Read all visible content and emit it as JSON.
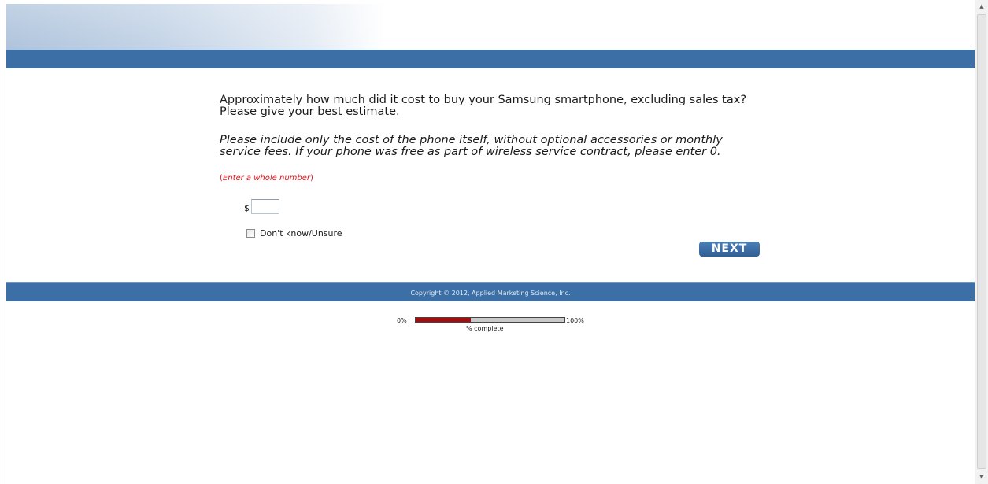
{
  "question": {
    "text": "Approximately how much did it cost to buy your Samsung smartphone, excluding sales tax? Please give your best estimate.",
    "instructions": "Please include only the cost of the phone itself, without optional accessories or monthly service fees. If your phone was free as part of wireless service contract, please enter 0.",
    "hint_open": "(",
    "hint": "Enter a whole number",
    "hint_close": ")"
  },
  "answer": {
    "currency_symbol": "$",
    "amount_value": "",
    "dont_know_label": "Don't know/Unsure",
    "dont_know_checked": false
  },
  "navigation": {
    "next_label": "NEXT"
  },
  "footer": {
    "copyright": "Copyright © 2012, Applied Marketing Science, Inc."
  },
  "progress": {
    "start_label": "0%",
    "end_label": "100%",
    "caption": "% complete",
    "percent_complete": 37
  },
  "colors": {
    "bar_blue": "#3b6fa6",
    "progress_fill": "#a80d0d",
    "hint_red": "#e0141e"
  },
  "scrollbar": {
    "up_icon": "triangle-up",
    "down_icon": "triangle-down"
  }
}
